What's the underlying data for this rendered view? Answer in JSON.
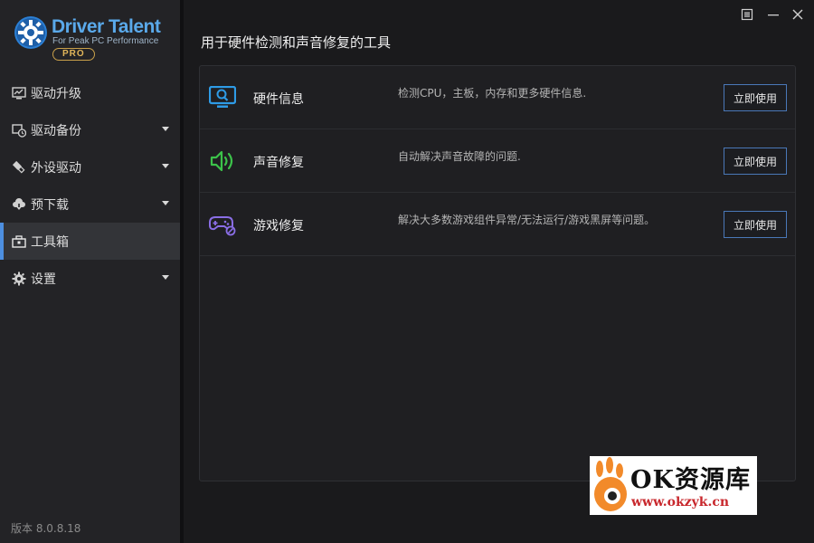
{
  "app": {
    "brand": "Driver Talent",
    "tagline": "For Peak PC Performance",
    "edition": "PRO"
  },
  "sidebar": {
    "items": [
      {
        "label": "驱动升级",
        "icon": "monitor-chart-icon",
        "has_submenu": false,
        "active": false
      },
      {
        "label": "驱动备份",
        "icon": "backup-clock-icon",
        "has_submenu": true,
        "active": false
      },
      {
        "label": "外设驱动",
        "icon": "usb-plug-icon",
        "has_submenu": true,
        "active": false
      },
      {
        "label": "预下载",
        "icon": "cloud-download-icon",
        "has_submenu": true,
        "active": false
      },
      {
        "label": "工具箱",
        "icon": "toolbox-icon",
        "has_submenu": false,
        "active": true
      },
      {
        "label": "设置",
        "icon": "gear-icon",
        "has_submenu": true,
        "active": false
      }
    ],
    "version": "版本 8.0.8.18"
  },
  "titlebar": {
    "buttons": [
      "menu-icon",
      "minimize-icon",
      "close-icon"
    ]
  },
  "main": {
    "title": "用于硬件检测和声音修复的工具",
    "tools": [
      {
        "name": "硬件信息",
        "description": "检测CPU，主板，内存和更多硬件信息.",
        "button": "立即使用",
        "icon": "monitor-search-icon",
        "color": "#2e9be6"
      },
      {
        "name": "声音修复",
        "description": "自动解决声音故障的问题.",
        "button": "立即使用",
        "icon": "speaker-icon",
        "color": "#3cc24a"
      },
      {
        "name": "游戏修复",
        "description": "解决大多数游戏组件异常/无法运行/游戏黑屏等问题。",
        "button": "立即使用",
        "icon": "gamepad-icon",
        "color": "#8a6ee6"
      }
    ]
  },
  "watermark": {
    "line1": "OK资源库",
    "line2": "www.okzyk.cn"
  },
  "colors": {
    "accent": "#4d8fe0",
    "sidebar_bg": "#232326",
    "main_bg": "#1a1a1c"
  }
}
